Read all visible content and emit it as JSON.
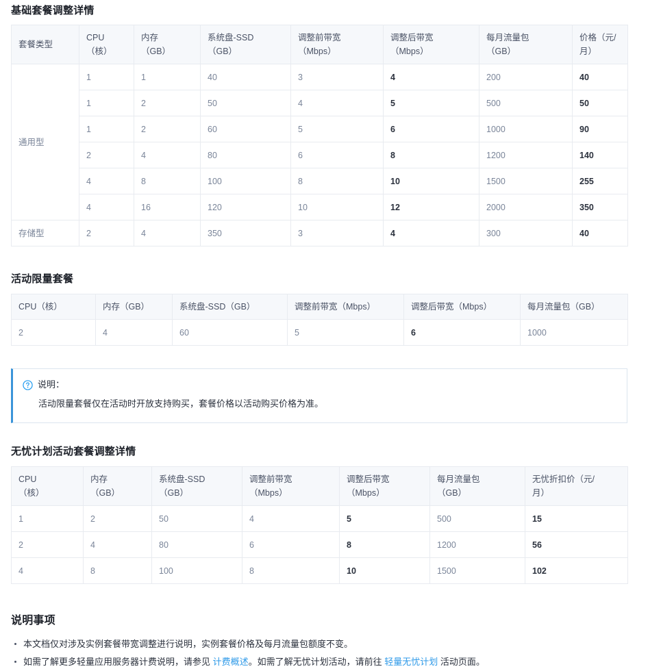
{
  "sections": {
    "basic_title": "基础套餐调整详情",
    "promo_title": "活动限量套餐",
    "worryfree_title": "无忧计划活动套餐调整详情",
    "notes_title": "说明事项"
  },
  "basic_table": {
    "headers": [
      "套餐类型",
      "CPU\n（核）",
      "内存\n（GB）",
      "系统盘-SSD\n（GB）",
      "调整前带宽\n（Mbps）",
      "调整后带宽\n（Mbps）",
      "每月流量包\n（GB）",
      "价格（元/月）"
    ],
    "headers_line1": [
      "套餐类型",
      "CPU",
      "内存",
      "系统盘-SSD",
      "调整前带宽",
      "调整后带宽",
      "每月流量包",
      "价格（元/"
    ],
    "headers_line2": [
      "",
      "（核）",
      "（GB）",
      "（GB）",
      "（Mbps）",
      "（Mbps）",
      "（GB）",
      "月）"
    ],
    "groups": [
      {
        "label": "通用型",
        "rows": [
          {
            "cpu": "1",
            "mem": "1",
            "disk": "40",
            "bw_before": "3",
            "bw_after": "4",
            "traffic": "200",
            "price": "40"
          },
          {
            "cpu": "1",
            "mem": "2",
            "disk": "50",
            "bw_before": "4",
            "bw_after": "5",
            "traffic": "500",
            "price": "50"
          },
          {
            "cpu": "1",
            "mem": "2",
            "disk": "60",
            "bw_before": "5",
            "bw_after": "6",
            "traffic": "1000",
            "price": "90"
          },
          {
            "cpu": "2",
            "mem": "4",
            "disk": "80",
            "bw_before": "6",
            "bw_after": "8",
            "traffic": "1200",
            "price": "140"
          },
          {
            "cpu": "4",
            "mem": "8",
            "disk": "100",
            "bw_before": "8",
            "bw_after": "10",
            "traffic": "1500",
            "price": "255"
          },
          {
            "cpu": "4",
            "mem": "16",
            "disk": "120",
            "bw_before": "10",
            "bw_after": "12",
            "traffic": "2000",
            "price": "350"
          }
        ]
      },
      {
        "label": "存储型",
        "rows": [
          {
            "cpu": "2",
            "mem": "4",
            "disk": "350",
            "bw_before": "3",
            "bw_after": "4",
            "traffic": "300",
            "price": "40"
          }
        ]
      }
    ]
  },
  "promo_table": {
    "headers": [
      "CPU（核）",
      "内存（GB）",
      "系统盘-SSD（GB）",
      "调整前带宽（Mbps）",
      "调整后带宽（Mbps）",
      "每月流量包（GB）"
    ],
    "rows": [
      {
        "cpu": "2",
        "mem": "4",
        "disk": "60",
        "bw_before": "5",
        "bw_after": "6",
        "traffic": "1000"
      }
    ]
  },
  "note": {
    "icon": "question-circle-icon",
    "label": "说明：",
    "text": "活动限量套餐仅在活动时开放支持购买，套餐价格以活动购买价格为准。",
    "accent_color": "#3a94d9"
  },
  "worryfree_table": {
    "headers_line1": [
      "CPU",
      "内存",
      "系统盘-SSD",
      "调整前带宽",
      "调整后带宽",
      "每月流量包",
      "无忧折扣价（元/"
    ],
    "headers_line2": [
      "（核）",
      "（GB）",
      "（GB）",
      "（Mbps）",
      "（Mbps）",
      "（GB）",
      "月）"
    ],
    "rows": [
      {
        "cpu": "1",
        "mem": "2",
        "disk": "50",
        "bw_before": "4",
        "bw_after": "5",
        "traffic": "500",
        "price": "15"
      },
      {
        "cpu": "2",
        "mem": "4",
        "disk": "80",
        "bw_before": "6",
        "bw_after": "8",
        "traffic": "1200",
        "price": "56"
      },
      {
        "cpu": "4",
        "mem": "8",
        "disk": "100",
        "bw_before": "8",
        "bw_after": "10",
        "traffic": "1500",
        "price": "102"
      }
    ]
  },
  "notes_list": {
    "item1": "本文档仅对涉及实例套餐带宽调整进行说明，实例套餐价格及每月流量包额度不变。",
    "item2_part1": "如需了解更多轻量应用服务器计费说明，请参见 ",
    "item2_link1": "计费概述",
    "item2_part2": "。如需了解无忧计划活动，请前往 ",
    "item2_link2": "轻量无忧计划",
    "item2_part3": " 活动页面。"
  },
  "colors": {
    "link": "#2f9ae8",
    "header_bg": "#f6f8fb",
    "border": "#e8ebf0",
    "text": "#2b313d",
    "muted": "#7a8599"
  }
}
